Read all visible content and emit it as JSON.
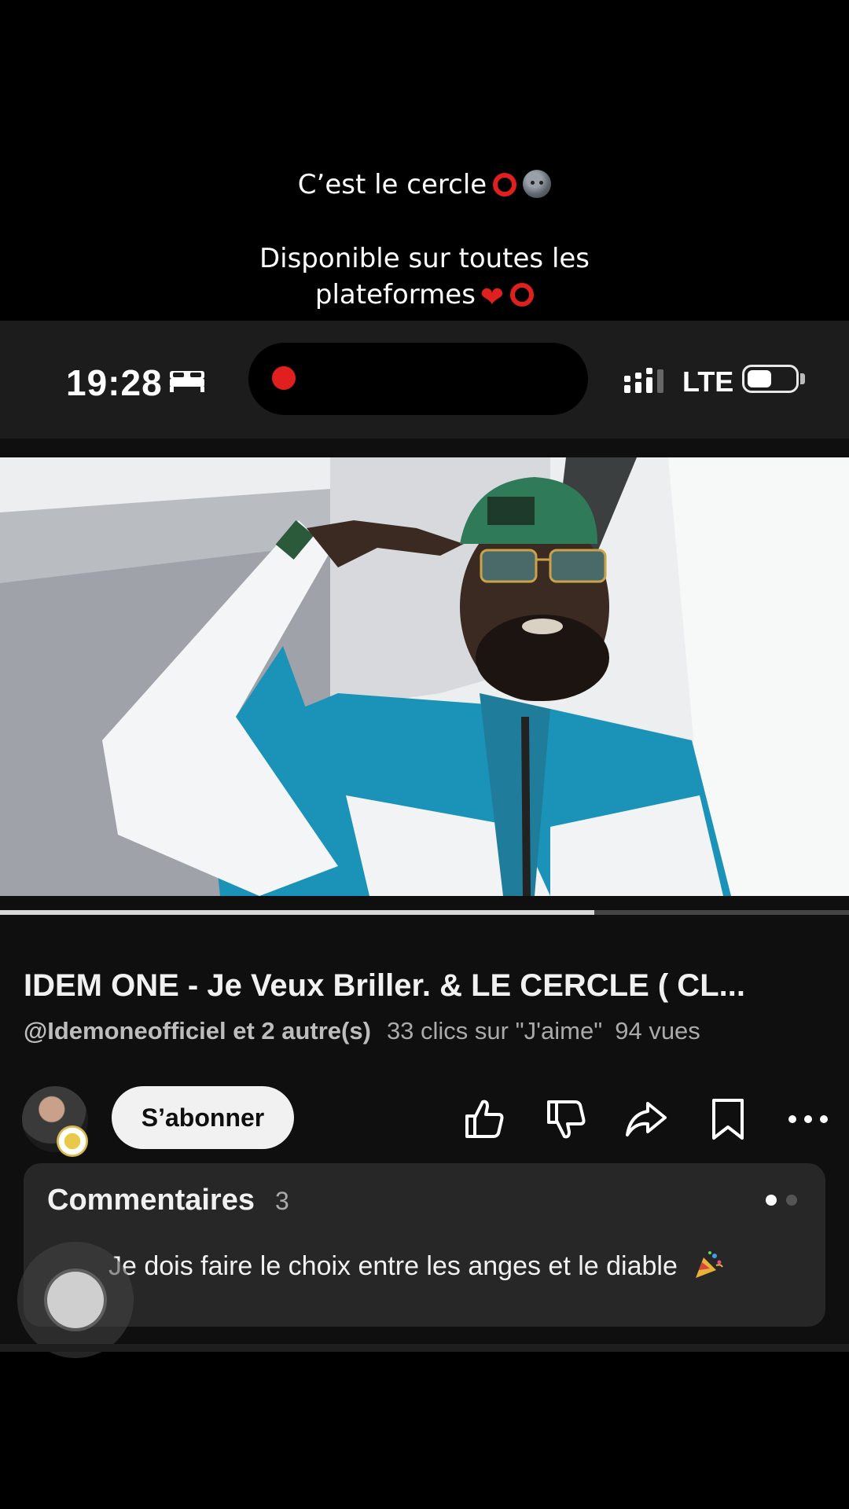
{
  "overlay": {
    "caption_line1": "C’est le cercle",
    "caption_line2": "Disponible sur toutes les",
    "caption_line3": "plateformes"
  },
  "status_bar": {
    "time": "19:28",
    "network": "LTE",
    "icons": [
      "bed-icon",
      "recording-dot-icon",
      "signal-icon",
      "battery-icon"
    ]
  },
  "video": {
    "title": "IDEM ONE - Je Veux Briller. & LE CERCLE ( CL...",
    "channel": "@Idemoneofficiel et 2 autre(s)",
    "likes": "33 clics sur \"J'aime\"",
    "views": "94 vues",
    "progress_fraction": 0.7
  },
  "actions": {
    "subscribe_label": "S’abonner",
    "icons": [
      "like-icon",
      "dislike-icon",
      "share-icon",
      "save-icon",
      "more-icon"
    ]
  },
  "comments": {
    "title": "Commentaires",
    "count": "3",
    "preview": "Je dois faire le choix entre les anges et le diable"
  },
  "colors": {
    "accent_red": "#e0201e",
    "background": "#0f0f0f",
    "comment_card": "#272727"
  }
}
